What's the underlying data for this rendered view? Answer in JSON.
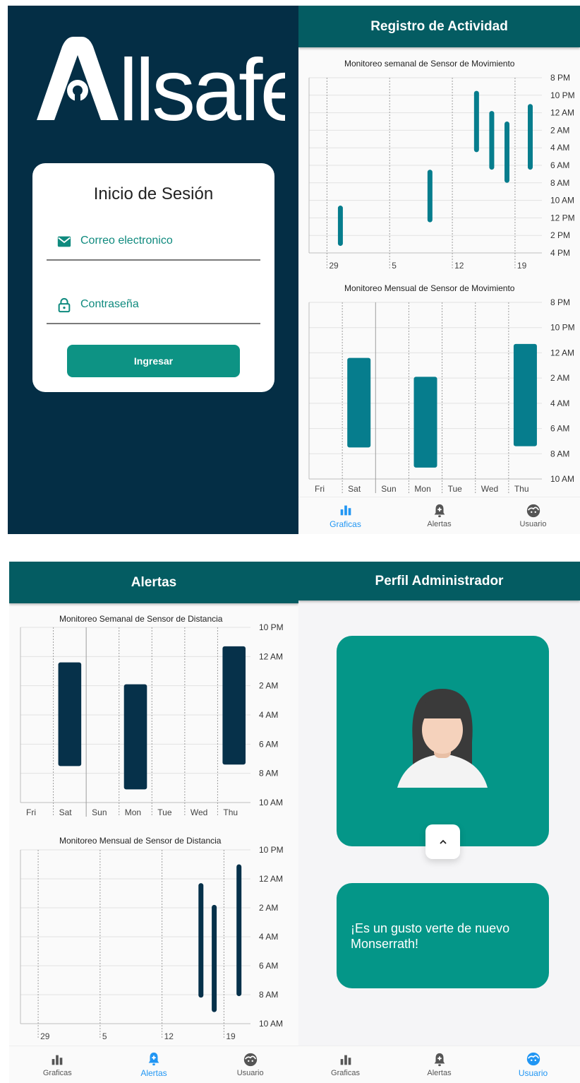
{
  "colors": {
    "login_bg": "#042e45",
    "appbar": "#045c62",
    "primary": "#0d9384",
    "bar_teal": "#067d8d",
    "bar_navy": "#06314a",
    "active_tab": "#2196f3"
  },
  "login": {
    "logo_text": "Allsafe",
    "title": "Inicio de Sesión",
    "email_label": "Correo electronico",
    "email_icon": "mail-icon",
    "password_label": "Contraseña",
    "password_icon": "lock-icon",
    "submit_label": "Ingresar"
  },
  "registro": {
    "appbar_title": "Registro de Actividad",
    "weekly_chart": {
      "title": "Monitoreo semanal de Sensor de Movimiento"
    },
    "monthly_chart": {
      "title": "Monitoreo Mensual de Sensor de Movimiento"
    }
  },
  "alertas": {
    "appbar_title": "Alertas",
    "weekly_chart": {
      "title": "Monitoreo Semanal de Sensor de Distancia"
    },
    "monthly_chart": {
      "title": "Monitoreo Mensual de Sensor de Distancia"
    }
  },
  "perfil": {
    "appbar_title": "Perfil Administrador",
    "welcome_message": "¡Es un gusto verte de nuevo Monserrath!",
    "expand_icon": "chevron-up-icon"
  },
  "nav": {
    "items": [
      {
        "label": "Graficas",
        "icon": "bar-chart-icon"
      },
      {
        "label": "Alertas",
        "icon": "bell-plus-icon"
      },
      {
        "label": "Usuario",
        "icon": "face-icon"
      }
    ]
  },
  "chart_data": [
    {
      "id": "mov_semanal",
      "type": "range-bar",
      "title": "Monitoreo semanal de Sensor de Movimiento",
      "x_ticks": [
        "29",
        "5",
        "12",
        "19"
      ],
      "y_ticks": [
        "8 PM",
        "10 PM",
        "12 AM",
        "2 AM",
        "4 AM",
        "6 AM",
        "8 AM",
        "10 AM",
        "12 PM",
        "2 PM",
        "4 PM"
      ],
      "ylim_hours": [
        20,
        40
      ],
      "bars": [
        {
          "x": 3.5,
          "from": 34.6,
          "to": 39.2
        },
        {
          "x": 13.5,
          "from": 30.5,
          "to": 36.5
        },
        {
          "x": 18.7,
          "from": 21.5,
          "to": 28.5
        },
        {
          "x": 20.4,
          "from": 23.8,
          "to": 30.5
        },
        {
          "x": 22.1,
          "from": 25.0,
          "to": 32.0
        },
        {
          "x": 24.7,
          "from": 23.0,
          "to": 30.5
        }
      ]
    },
    {
      "id": "mov_mensual",
      "type": "range-bar",
      "title": "Monitoreo Mensual de Sensor de Movimiento",
      "x_ticks": [
        "Fri",
        "Sat",
        "Sun",
        "Mon",
        "Tue",
        "Wed",
        "Thu"
      ],
      "y_ticks": [
        "8 PM",
        "10 PM",
        "12 AM",
        "2 AM",
        "4 AM",
        "6 AM",
        "8 AM",
        "10 AM"
      ],
      "ylim_hours": [
        20,
        34
      ],
      "bars": [
        {
          "day": "Sat",
          "from": 24.4,
          "to": 31.5
        },
        {
          "day": "Mon",
          "from": 25.9,
          "to": 33.1
        },
        {
          "day": "Thu",
          "from": 23.3,
          "to": 31.4
        }
      ]
    },
    {
      "id": "dist_semanal",
      "type": "range-bar",
      "title": "Monitoreo Semanal de Sensor de Distancia",
      "x_ticks": [
        "Fri",
        "Sat",
        "Sun",
        "Mon",
        "Tue",
        "Wed",
        "Thu"
      ],
      "y_ticks": [
        "10 PM",
        "12 AM",
        "2 AM",
        "4 AM",
        "6 AM",
        "8 AM",
        "10 AM"
      ],
      "ylim_hours": [
        22,
        34
      ],
      "bars": [
        {
          "day": "Sat",
          "from": 24.4,
          "to": 31.5
        },
        {
          "day": "Mon",
          "from": 25.9,
          "to": 33.1
        },
        {
          "day": "Thu",
          "from": 23.3,
          "to": 31.4
        }
      ]
    },
    {
      "id": "dist_mensual",
      "type": "range-bar",
      "title": "Monitoreo Mensual de Sensor de Distancia",
      "x_ticks": [
        "29",
        "5",
        "12",
        "19"
      ],
      "y_ticks": [
        "10 PM",
        "12 AM",
        "2 AM",
        "4 AM",
        "6 AM",
        "8 AM",
        "10 AM"
      ],
      "ylim_hours": [
        22,
        34
      ],
      "bars": [
        {
          "x": 20.4,
          "from": 24.3,
          "to": 32.2
        },
        {
          "x": 21.9,
          "from": 25.8,
          "to": 33.2
        },
        {
          "x": 24.7,
          "from": 23.0,
          "to": 32.1
        }
      ]
    }
  ]
}
